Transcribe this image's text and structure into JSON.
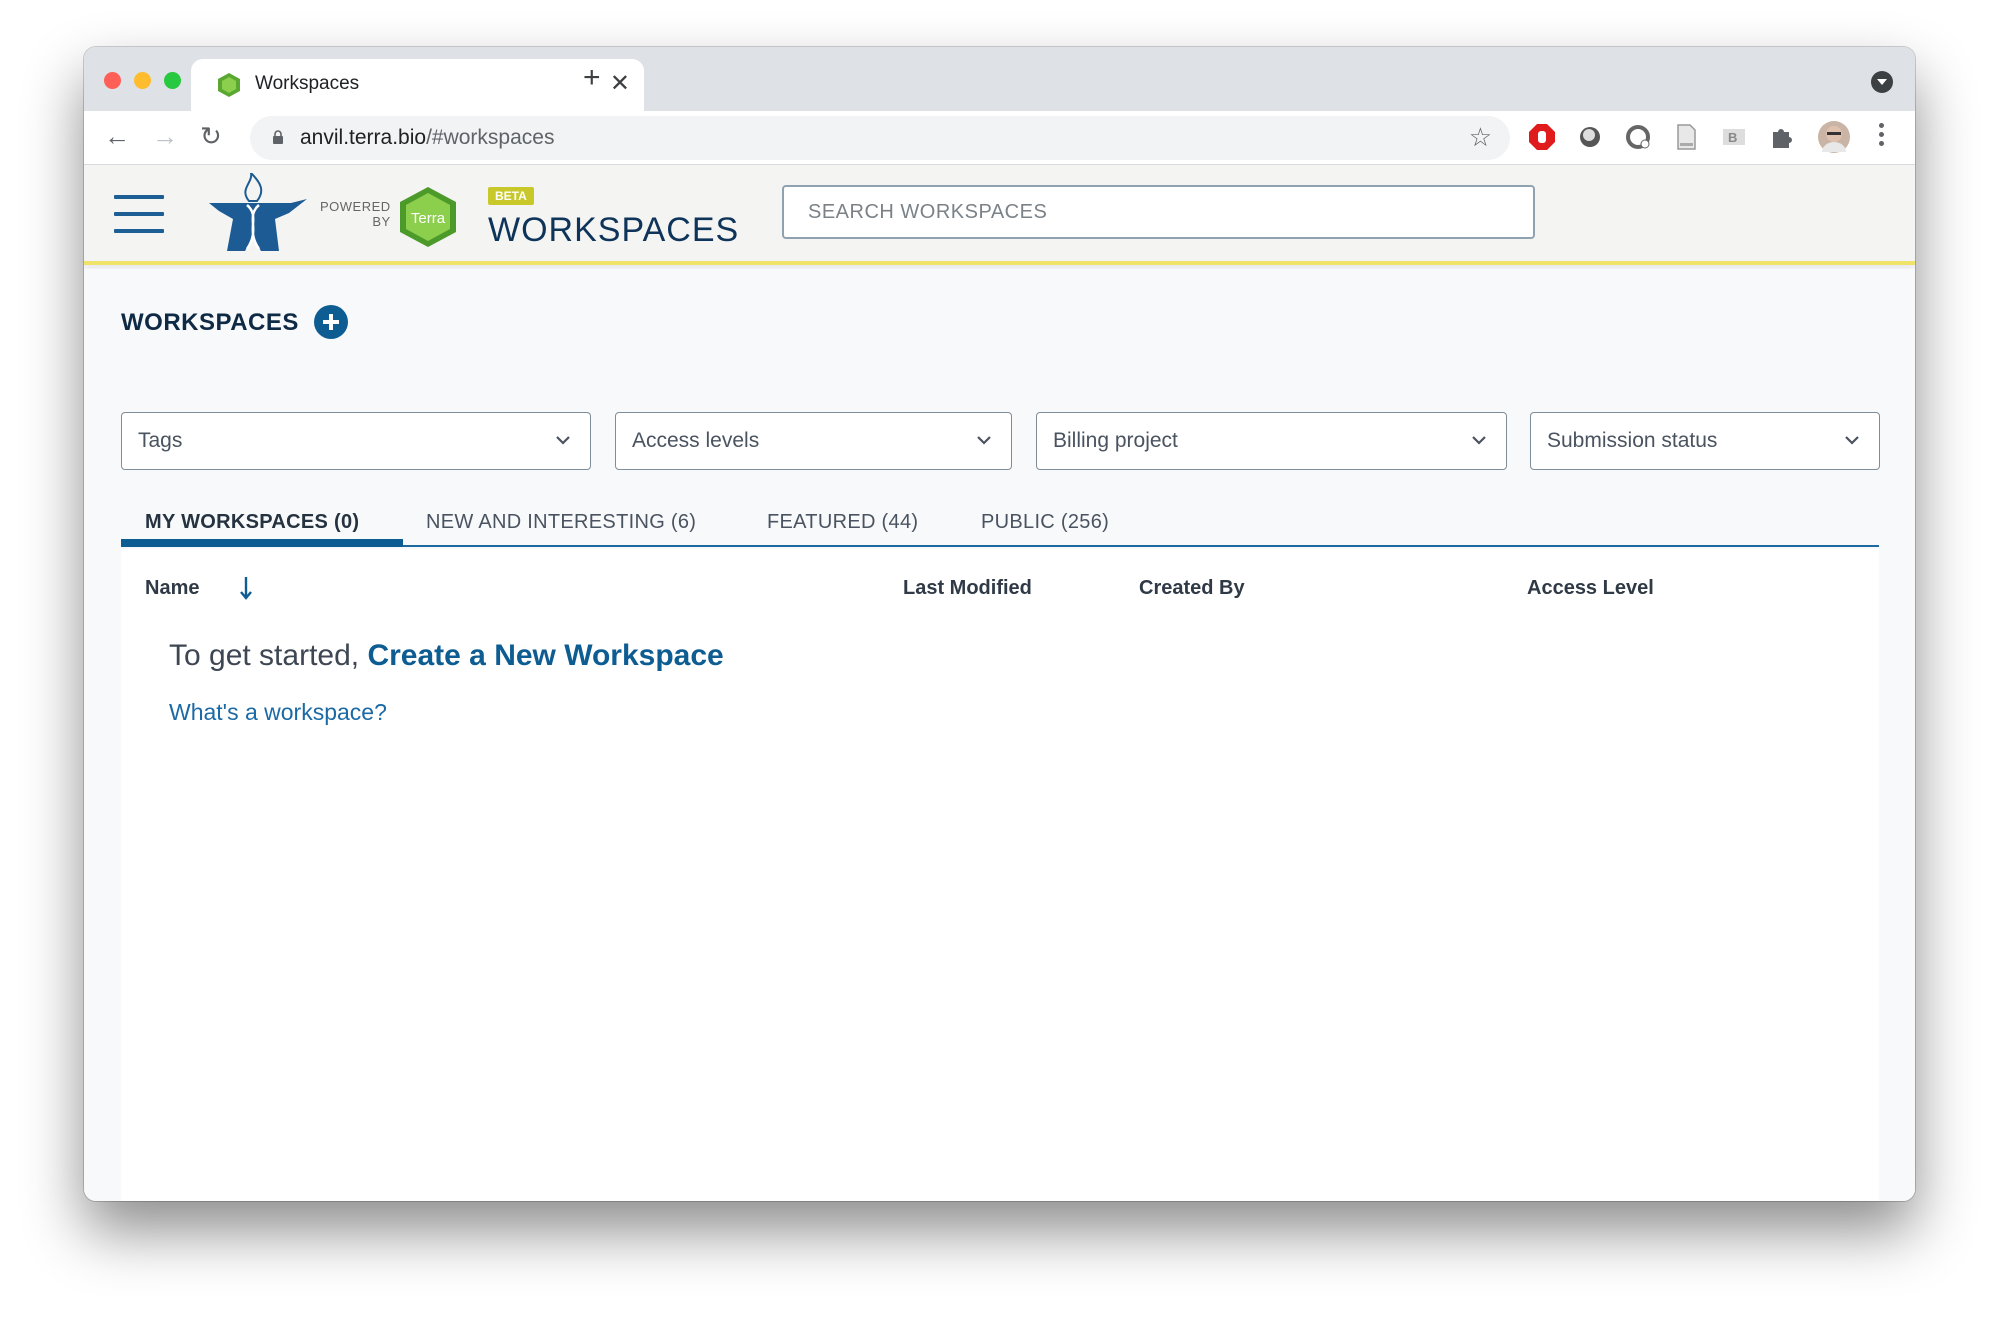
{
  "browser": {
    "tab_title": "Workspaces",
    "url_host": "anvil.terra.bio",
    "url_path": "/#workspaces",
    "icons": [
      "back-arrow",
      "forward-arrow",
      "reload",
      "lock",
      "star",
      "adblock-hand",
      "extension-circle",
      "extension-refresh",
      "extension-document",
      "extension-b",
      "puzzle",
      "profile-avatar",
      "more-vert",
      "tab-search"
    ]
  },
  "header": {
    "powered_by_line1": "POWERED",
    "powered_by_line2": "BY",
    "terra_label": "Terra",
    "beta_label": "BETA",
    "title": "WORKSPACES",
    "search_placeholder": "SEARCH WORKSPACES"
  },
  "main": {
    "section_title": "WORKSPACES",
    "filters": [
      {
        "label": "Tags"
      },
      {
        "label": "Access levels"
      },
      {
        "label": "Billing project"
      },
      {
        "label": "Submission status"
      }
    ],
    "tabs": [
      {
        "label": "MY WORKSPACES (0)",
        "active": true
      },
      {
        "label": "NEW AND INTERESTING (6)",
        "active": false
      },
      {
        "label": "FEATURED (44)",
        "active": false
      },
      {
        "label": "PUBLIC (256)",
        "active": false
      }
    ],
    "columns": [
      "Name",
      "Last Modified",
      "Created By",
      "Access Level"
    ],
    "sort": {
      "column": "Name",
      "direction": "descending"
    },
    "empty_prefix": "To get started, ",
    "empty_link": "Create a New Workspace",
    "help_link": "What's a workspace?"
  },
  "colors": {
    "brand_blue": "#0d5c92",
    "header_accent": "#f0e36a",
    "beta_badge": "#c8c82a",
    "terra_green": "#7cc242"
  }
}
